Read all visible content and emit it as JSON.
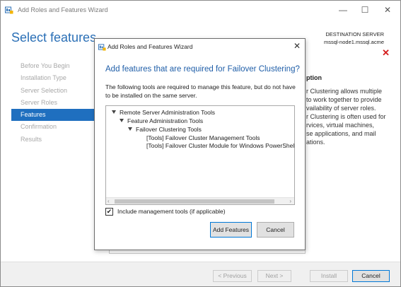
{
  "window": {
    "title": "Add Roles and Features Wizard",
    "minimize_glyph": "—",
    "maximize_glyph": "☐",
    "close_glyph": "✕"
  },
  "page": {
    "title": "Select features",
    "destination_label": "DESTINATION SERVER",
    "destination_server": "mssql-node1.mssql.acme",
    "error_glyph": "✕"
  },
  "steps": [
    {
      "label": "Before You Begin",
      "active": false
    },
    {
      "label": "Installation Type",
      "active": false
    },
    {
      "label": "Server Selection",
      "active": false
    },
    {
      "label": "Server Roles",
      "active": false
    },
    {
      "label": "Features",
      "active": true
    },
    {
      "label": "Confirmation",
      "active": false
    },
    {
      "label": "Results",
      "active": false
    }
  ],
  "description": {
    "heading": "ption",
    "body": "r Clustering allows multiple\nto work together to provide\nvailability of server roles.\nr Clustering is often used for\nrvices, virtual machines,\nse applications, and mail\nations."
  },
  "footer": {
    "previous": "< Previous",
    "next": "Next >",
    "install": "Install",
    "cancel": "Cancel"
  },
  "dialog": {
    "title": "Add Roles and Features Wizard",
    "close_glyph": "✕",
    "heading": "Add features that are required for Failover Clustering?",
    "text": "The following tools are required to manage this feature, but do not have to be installed on the same server.",
    "tree": [
      {
        "label": "Remote Server Administration Tools",
        "expanded": true
      },
      {
        "label": "Feature Administration Tools",
        "expanded": true
      },
      {
        "label": "Failover Clustering Tools",
        "expanded": true
      },
      {
        "label": "[Tools] Failover Cluster Management Tools",
        "expanded": false
      },
      {
        "label": "[Tools] Failover Cluster Module for Windows PowerShell",
        "expanded": false
      }
    ],
    "scroll_left": "‹",
    "scroll_right": "›",
    "include_tools_label": "Include management tools (if applicable)",
    "include_tools_checked": true,
    "checkmark": "✔",
    "add_features": "Add Features",
    "cancel": "Cancel"
  }
}
